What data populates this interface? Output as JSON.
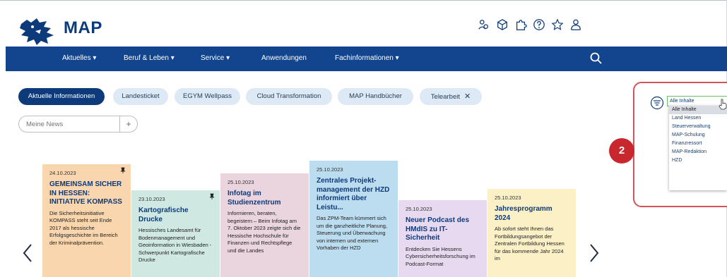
{
  "header": {
    "logo_text": "MAP",
    "icons": [
      "community-icon",
      "cube-icon",
      "puzzle-icon",
      "help-icon",
      "star-icon",
      "user-icon"
    ]
  },
  "nav": {
    "items": [
      {
        "label": "Aktuelles ▾"
      },
      {
        "label": "Beruf & Leben ▾"
      },
      {
        "label": "Service ▾"
      },
      {
        "label": "Anwendungen"
      },
      {
        "label": "Fachinformationen ▾"
      }
    ]
  },
  "chips": [
    {
      "label": "Aktuelle Informationen",
      "active": true
    },
    {
      "label": "Landesticket"
    },
    {
      "label": "EGYM Wellpass"
    },
    {
      "label": "Cloud Transformation"
    },
    {
      "label": "MAP Handbücher"
    },
    {
      "label": "Telearbeit",
      "close": "✕"
    }
  ],
  "news_input": {
    "placeholder": "Meine News",
    "add_label": "+"
  },
  "cards": [
    {
      "date": "24.10.2023",
      "title": "GEMEINSAM SICHER IN HESSEN: INITIATIVE KOMPASS",
      "text": "Die Sicherheitsinitiative KOMPASS steht seit Ende 2017 als hessische Erfolgsgeschichte im Bereich der Kriminalprävention.",
      "color": "#f9d6ad"
    },
    {
      "date": "23.10.2023",
      "title": "Kartografische Drucke",
      "text": "Hessisches Landesamt für Bodenmanagement und Geoinformation in Wiesbaden - Schwerpunkt Kartografische Drucke",
      "color": "#cfe9e2"
    },
    {
      "date": "25.10.2023",
      "title": "Infotag im Studienzentrum",
      "text": "Informieren, beraten, begeistern – Beim Infotag am 7. Oktober 2023 zeigte sich die Hessische Hochschule für Finanzen und Rechtspflege und die Landes",
      "color": "#ead4dd"
    },
    {
      "date": "25.10.2023",
      "title": "Zentrales Projekt-management der HZD informiert über Leistu...",
      "text": "Das ZPM-Team kümmert sich um die ganzheitliche Planung, Steuerung und Überwachung von internen und externen Vorhaben der HZD",
      "color": "#bcdcef"
    },
    {
      "date": "25.10.2023",
      "title": "Neuer Podcast des HMdIS zu IT-Sicherheit",
      "text": "Entdecken Sie Hessens Cybersicherheitsforschung im Podcast-Format",
      "color": "#e6d9f0"
    },
    {
      "date": "25.10.2023",
      "title": "Jahresprogramm 2024",
      "text": "Ab sofort steht Ihnen das Fortbildungsangebot der Zentralen Fortbildung Hessen für das kommende Jahr 2024 im",
      "color": "#fcf0c7"
    }
  ],
  "filter": {
    "selected": "Alle Inhalte",
    "options": [
      "Alle Inhalte",
      "Land Hessen",
      "Steuerverwaltung",
      "MAP-Schulung",
      "Finanzressort",
      "MAP-Redaktion",
      "HZD"
    ]
  },
  "badge": "2",
  "colors": {
    "brand": "#13458e",
    "title_blue": "#0d3a7a",
    "callout_red": "#d4525a",
    "badge_red": "#c8272d"
  }
}
